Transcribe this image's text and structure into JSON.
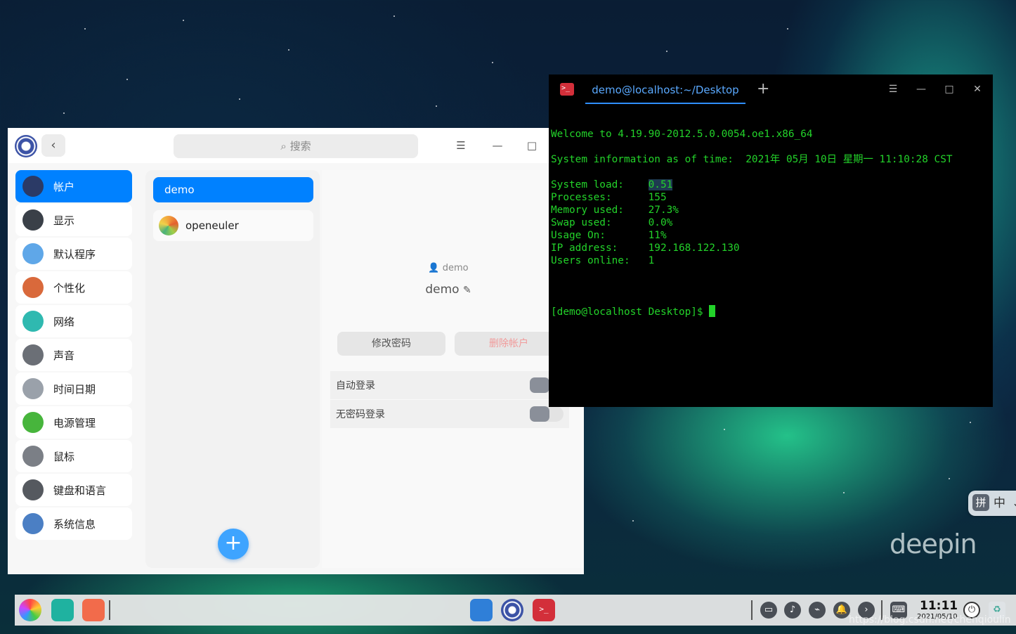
{
  "control_center": {
    "search_placeholder": "搜索",
    "back_symbol": "‹",
    "window_buttons": [
      "☰",
      "—",
      "□"
    ],
    "nav": [
      {
        "label": "帐户",
        "icon": "account-icon",
        "color": "#2b3a66",
        "active": true
      },
      {
        "label": "显示",
        "icon": "display-icon",
        "color": "#3a4048",
        "active": false
      },
      {
        "label": "默认程序",
        "icon": "default-apps-icon",
        "color": "#5fa7e8",
        "active": false
      },
      {
        "label": "个性化",
        "icon": "personalization-icon",
        "color": "#d9693b",
        "active": false
      },
      {
        "label": "网络",
        "icon": "network-icon",
        "color": "#2fb9b0",
        "active": false
      },
      {
        "label": "声音",
        "icon": "sound-icon",
        "color": "#6b6f76",
        "active": false
      },
      {
        "label": "时间日期",
        "icon": "clock-icon",
        "color": "#9aa1aa",
        "active": false
      },
      {
        "label": "电源管理",
        "icon": "battery-icon",
        "color": "#47b53c",
        "active": false
      },
      {
        "label": "鼠标",
        "icon": "mouse-icon",
        "color": "#7b7f86",
        "active": false
      },
      {
        "label": "键盘和语言",
        "icon": "keyboard-icon",
        "color": "#55595f",
        "active": false
      },
      {
        "label": "系统信息",
        "icon": "system-info-icon",
        "color": "#4b7fc4",
        "active": false
      }
    ],
    "users": [
      {
        "name": "demo",
        "active": true
      },
      {
        "name": "openeuler",
        "active": false
      }
    ],
    "add_symbol": "+",
    "detail": {
      "username_small": "demo",
      "display_name": "demo",
      "change_password": "修改密码",
      "delete_account": "删除帐户",
      "auto_login": "自动登录",
      "passwordless_login": "无密码登录"
    }
  },
  "terminal": {
    "tab_title": "demo@localhost:~/Desktop",
    "add_tab": "+",
    "window_buttons": [
      "☰",
      "—",
      "□",
      "✕"
    ],
    "lines": {
      "welcome": "Welcome to 4.19.90-2012.5.0.0054.oe1.x86_64",
      "sysinfo": "System information as of time:  2021年 05月 10日 星期一 11:10:28 CST",
      "load_label": "System load:    ",
      "load_value": "0.51",
      "processes": "Processes:      155",
      "memory": "Memory used:    27.3%",
      "swap": "Swap used:      0.0%",
      "usage": "Usage On:       11%",
      "ip": "IP address:     192.168.122.130",
      "users": "Users online:   1",
      "prompt": "[demo@localhost Desktop]$ "
    }
  },
  "ime": {
    "pin": "拼",
    "mode": "中",
    "extra": "⌄"
  },
  "desktop_logo": "deepin",
  "dock": {
    "time": "11:11",
    "date": "2021/05/10",
    "watermark": "https://blog.csdn.net/chenqioulin"
  }
}
